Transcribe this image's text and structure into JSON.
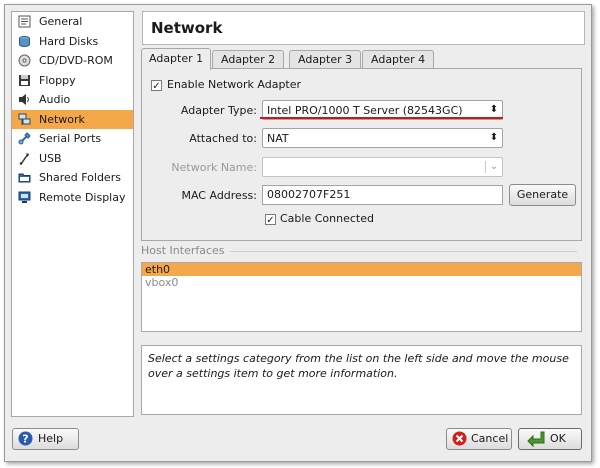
{
  "sidebar": {
    "items": [
      {
        "label": "General",
        "icon": "general-icon"
      },
      {
        "label": "Hard Disks",
        "icon": "hard-disk-icon"
      },
      {
        "label": "CD/DVD-ROM",
        "icon": "cdrom-icon"
      },
      {
        "label": "Floppy",
        "icon": "floppy-icon"
      },
      {
        "label": "Audio",
        "icon": "audio-icon"
      },
      {
        "label": "Network",
        "icon": "network-icon",
        "selected": true
      },
      {
        "label": "Serial Ports",
        "icon": "serial-port-icon"
      },
      {
        "label": "USB",
        "icon": "usb-icon"
      },
      {
        "label": "Shared Folders",
        "icon": "shared-folder-icon"
      },
      {
        "label": "Remote Display",
        "icon": "remote-display-icon"
      }
    ]
  },
  "header": {
    "title": "Network"
  },
  "tabs": [
    {
      "label": "Adapter 1",
      "active": true
    },
    {
      "label": "Adapter 2"
    },
    {
      "label": "Adapter 3"
    },
    {
      "label": "Adapter 4"
    }
  ],
  "adapter": {
    "enable_label": "Enable Network Adapter",
    "enable_checked": true,
    "type_label": "Adapter Type:",
    "type_value": "Intel PRO/1000 T Server (82543GC)",
    "attached_label": "Attached to:",
    "attached_value": "NAT",
    "netname_label": "Network Name:",
    "netname_value": "",
    "mac_label": "MAC Address:",
    "mac_value": "08002707F251",
    "generate_label": "Generate",
    "cable_label": "Cable Connected",
    "cable_checked": true
  },
  "host_interfaces": {
    "title": "Host Interfaces",
    "items": [
      "eth0",
      "vbox0"
    ]
  },
  "info_text": "Select a settings category from the list on the left side and move the mouse over a settings item to get more information.",
  "buttons": {
    "help": "Help",
    "cancel": "Cancel",
    "ok": "OK"
  },
  "colors": {
    "selection": "#f5a849",
    "highlight_line": "#d2131a",
    "dialog_bg": "#ededed"
  }
}
